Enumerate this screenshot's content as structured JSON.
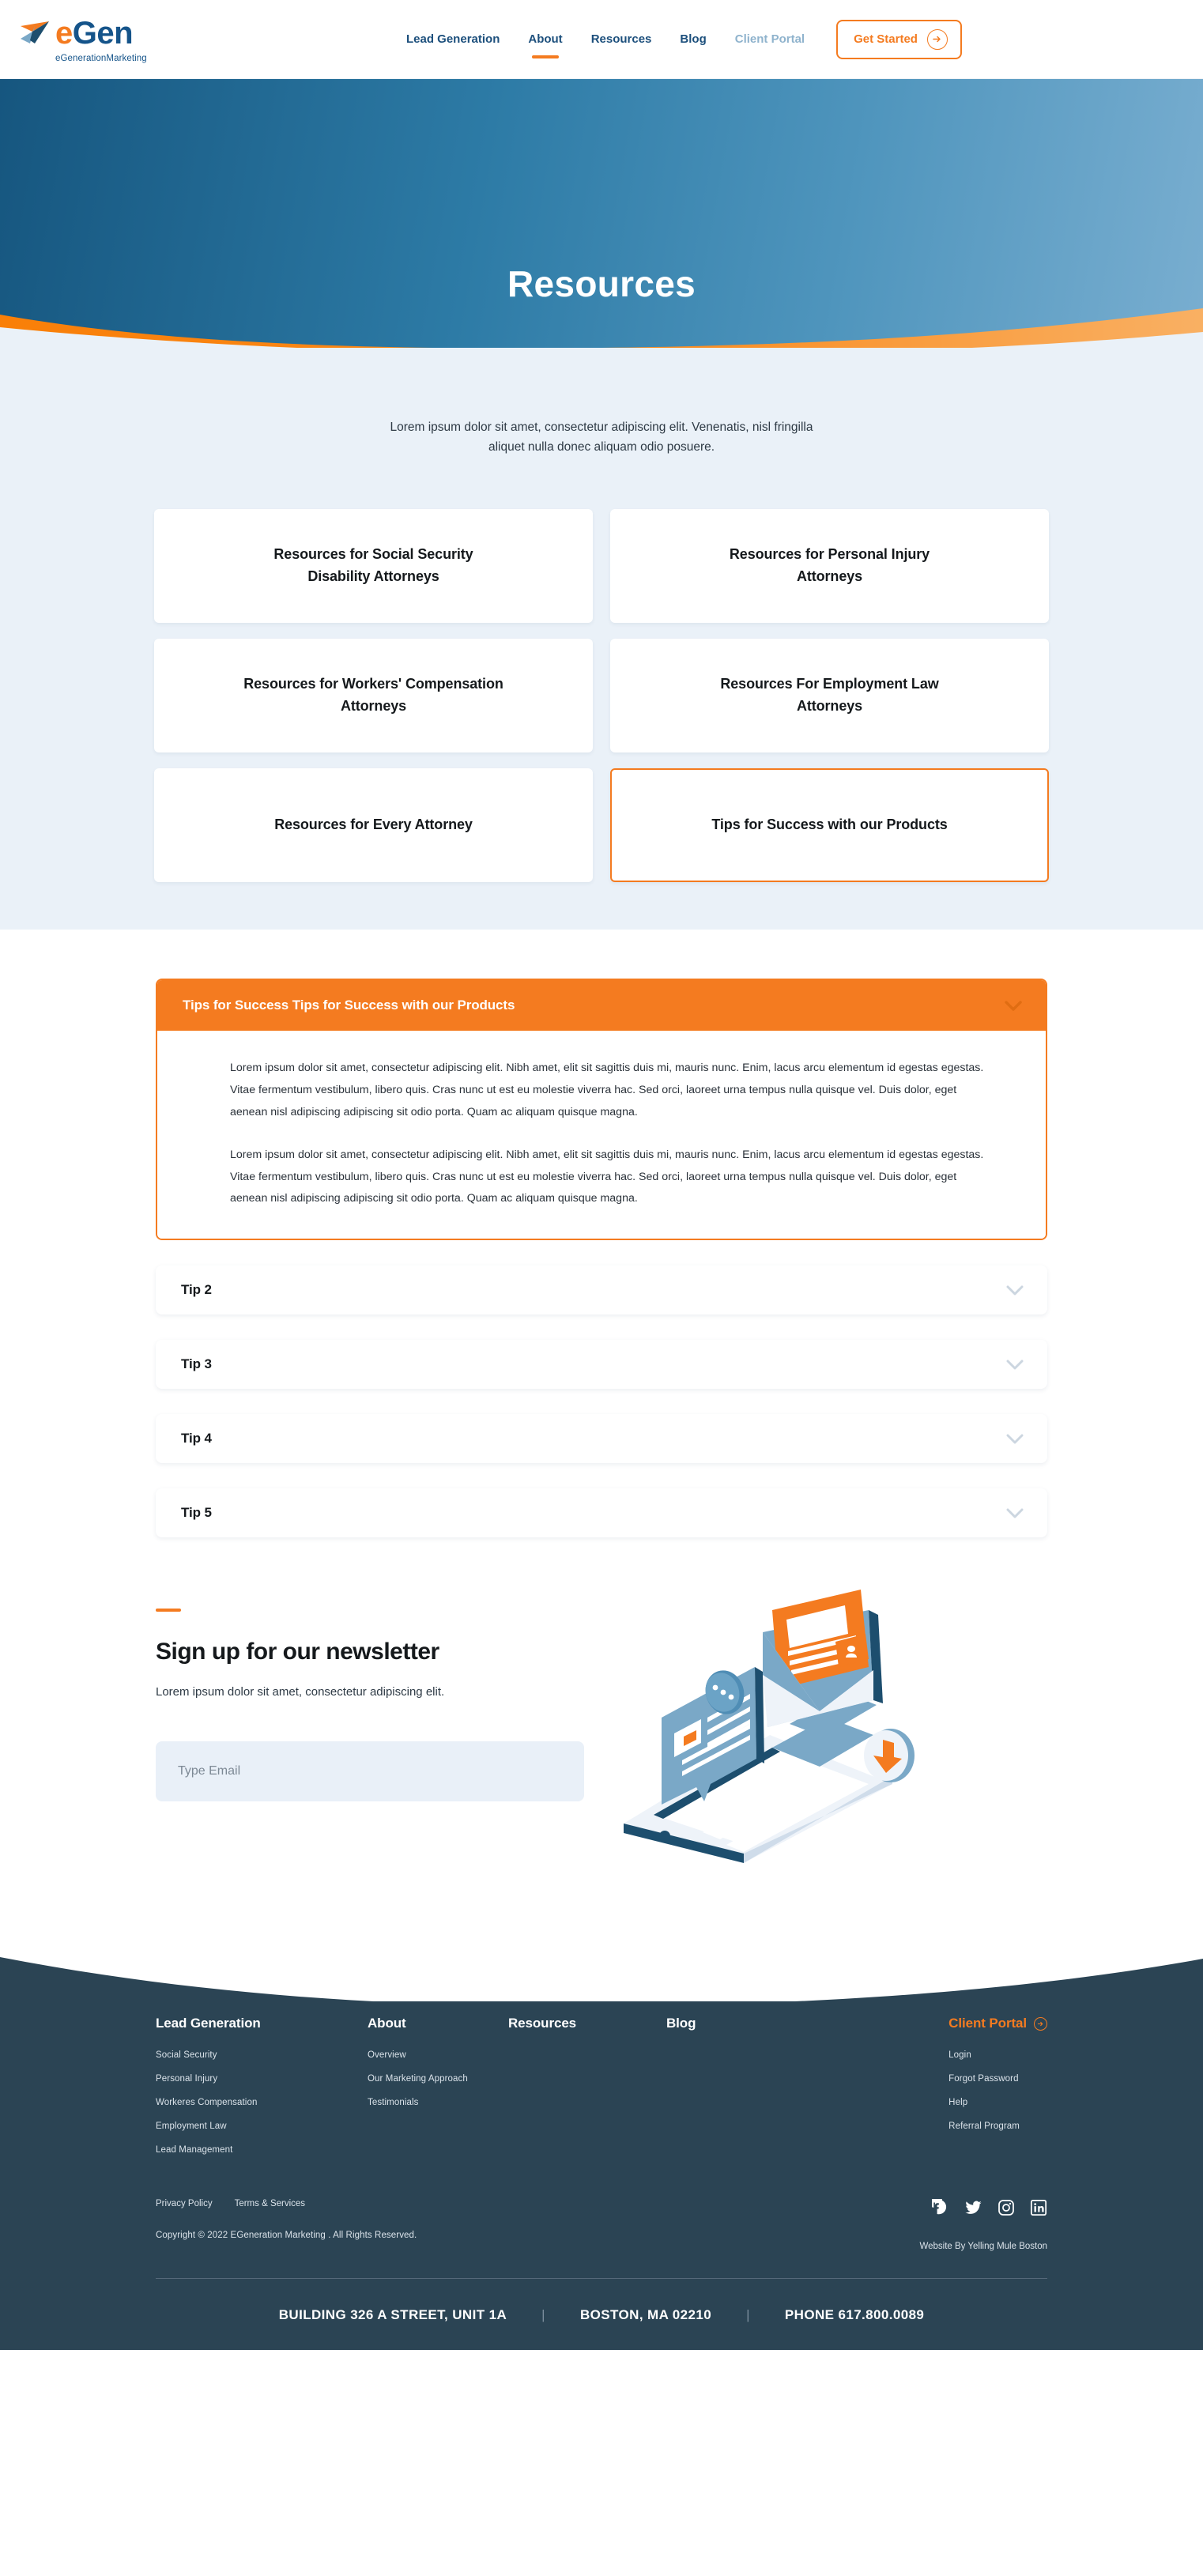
{
  "brand": {
    "logo_main_e": "e",
    "logo_main_gen": "Gen",
    "logo_sub": "eGenerationMarketing",
    "accent_orange": "#f47b20",
    "brand_blue": "#15548a",
    "footer_navy": "#2b4454"
  },
  "header": {
    "nav": [
      {
        "label": "Lead Generation",
        "state": "default"
      },
      {
        "label": "About",
        "state": "active"
      },
      {
        "label": "Resources",
        "state": "default"
      },
      {
        "label": "Blog",
        "state": "default"
      },
      {
        "label": "Client Portal",
        "state": "muted"
      }
    ],
    "cta": {
      "label": "Get Started",
      "icon": "arrow-right-circle-icon"
    }
  },
  "hero": {
    "title": "Resources"
  },
  "intro": {
    "text": "Lorem ipsum dolor sit amet, consectetur adipiscing elit. Venenatis, nisl fringilla aliquet nulla donec aliquam odio posuere."
  },
  "cards": [
    {
      "label": "Resources for Social Security Disability Attorneys",
      "selected": false
    },
    {
      "label": "Resources for Personal Injury Attorneys",
      "selected": false
    },
    {
      "label": "Resources for Workers' Compensation Attorneys",
      "selected": false
    },
    {
      "label": "Resources For Employment Law Attorneys",
      "selected": false
    },
    {
      "label": "Resources for Every Attorney",
      "selected": false
    },
    {
      "label": "Tips for Success with our Products",
      "selected": true
    }
  ],
  "accordion": [
    {
      "title": "Tips for Success Tips for Success with our Products",
      "open": true,
      "paragraphs": [
        "Lorem ipsum dolor sit amet, consectetur adipiscing elit. Nibh amet, elit sit sagittis duis mi, mauris nunc. Enim, lacus arcu elementum id egestas egestas. Vitae fermentum vestibulum, libero quis. Cras nunc ut est eu molestie viverra hac. Sed orci, laoreet urna tempus nulla quisque vel. Duis dolor, eget aenean nisl adipiscing adipiscing sit odio porta. Quam ac aliquam quisque magna.",
        "Lorem ipsum dolor sit amet, consectetur adipiscing elit. Nibh amet, elit sit sagittis duis mi, mauris nunc. Enim, lacus arcu elementum id egestas egestas. Vitae fermentum vestibulum, libero quis. Cras nunc ut est eu molestie viverra hac. Sed orci, laoreet urna tempus nulla quisque vel. Duis dolor, eget aenean nisl adipiscing adipiscing sit odio porta. Quam ac aliquam quisque magna."
      ]
    },
    {
      "title": "Tip 2",
      "open": false,
      "paragraphs": []
    },
    {
      "title": "Tip 3",
      "open": false,
      "paragraphs": []
    },
    {
      "title": "Tip 4",
      "open": false,
      "paragraphs": []
    },
    {
      "title": "Tip 5",
      "open": false,
      "paragraphs": []
    }
  ],
  "newsletter": {
    "title": "Sign up for our newsletter",
    "subtitle": "Lorem ipsum dolor sit amet, consectetur adipiscing elit.",
    "input_placeholder": "Type Email",
    "input_value": "",
    "illustration": "isometric-email-phone-illustration"
  },
  "footer": {
    "columns": [
      {
        "heading": "Lead Generation",
        "links": [
          "Social Security",
          "Personal Injury",
          "Workeres Compensation",
          "Employment Law",
          "Lead Management"
        ]
      },
      {
        "heading": "About",
        "links": [
          "Overview",
          "Our Marketing Approach",
          "Testimonials"
        ]
      },
      {
        "heading": "Resources",
        "links": []
      },
      {
        "heading": "Blog",
        "links": []
      },
      {
        "heading": "Client Portal",
        "heading_icon": "arrow-right-circle-icon",
        "links": [
          "Login",
          "Forgot Password",
          "Help",
          "Referral Program"
        ]
      }
    ],
    "legal": [
      "Privacy Policy",
      "Terms & Services"
    ],
    "copyright": "Copyright © 2022 EGeneration Marketing . All Rights Reserved.",
    "credit": "Website By Yelling Mule Boston",
    "social": [
      "facebook-icon",
      "twitter-icon",
      "instagram-icon",
      "linkedin-icon"
    ],
    "address": {
      "line1": "BUILDING 326 A STREET, UNIT 1A",
      "line2": "BOSTON, MA 02210",
      "line3": "PHONE 617.800.0089",
      "separator": "|"
    }
  }
}
